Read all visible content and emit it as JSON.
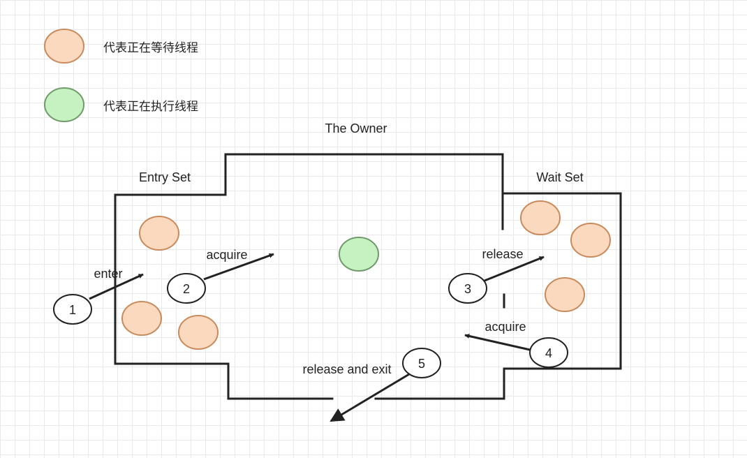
{
  "colors": {
    "waiting_fill": "#fbd9bf",
    "waiting_stroke": "#c98a5c",
    "running_fill": "#c6f2c2",
    "running_stroke": "#6f9a6b",
    "line": "#222222"
  },
  "legend": {
    "waiting_label": "代表正在等待线程",
    "running_label": "代表正在执行线程"
  },
  "regions": {
    "owner": "The Owner",
    "entry_set": "Entry Set",
    "wait_set": "Wait Set"
  },
  "steps": [
    {
      "number": "1",
      "label": "enter"
    },
    {
      "number": "2",
      "label": "acquire"
    },
    {
      "number": "3",
      "label": "release"
    },
    {
      "number": "4",
      "label": "acquire"
    },
    {
      "number": "5",
      "label": "release and exit"
    }
  ]
}
